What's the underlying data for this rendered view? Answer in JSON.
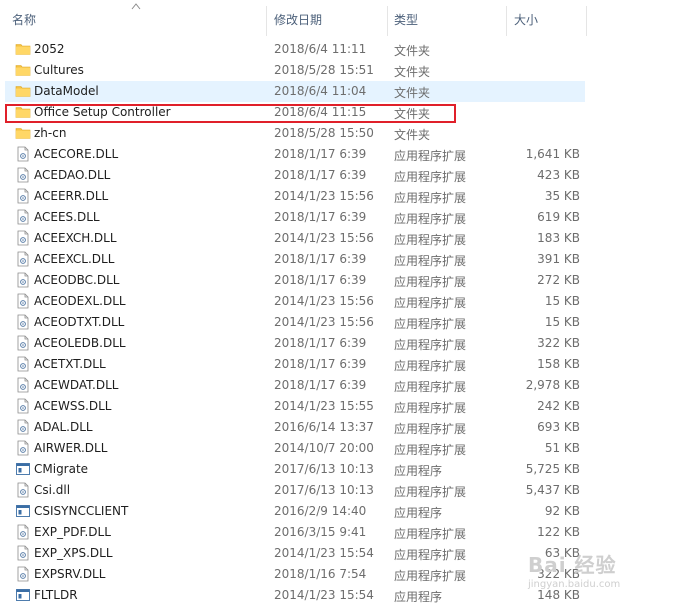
{
  "columns": {
    "name": "名称",
    "date": "修改日期",
    "type": "类型",
    "size": "大小"
  },
  "rows": [
    {
      "name": "2052",
      "date": "2018/6/4 11:11",
      "type": "文件夹",
      "size": "",
      "icon": "folder-icon"
    },
    {
      "name": "Cultures",
      "date": "2018/5/28 15:51",
      "type": "文件夹",
      "size": "",
      "icon": "folder-icon"
    },
    {
      "name": "DataModel",
      "date": "2018/6/4 11:04",
      "type": "文件夹",
      "size": "",
      "icon": "folder-icon",
      "selected": true
    },
    {
      "name": "Office Setup Controller",
      "date": "2018/6/4 11:15",
      "type": "文件夹",
      "size": "",
      "icon": "folder-icon",
      "highlighted": true
    },
    {
      "name": "zh-cn",
      "date": "2018/5/28 15:50",
      "type": "文件夹",
      "size": "",
      "icon": "folder-icon"
    },
    {
      "name": "ACECORE.DLL",
      "date": "2018/1/17 6:39",
      "type": "应用程序扩展",
      "size": "1,641 KB",
      "icon": "dll-file-icon"
    },
    {
      "name": "ACEDAO.DLL",
      "date": "2018/1/17 6:39",
      "type": "应用程序扩展",
      "size": "423 KB",
      "icon": "dll-file-icon"
    },
    {
      "name": "ACEERR.DLL",
      "date": "2014/1/23 15:56",
      "type": "应用程序扩展",
      "size": "35 KB",
      "icon": "dll-file-icon"
    },
    {
      "name": "ACEES.DLL",
      "date": "2018/1/17 6:39",
      "type": "应用程序扩展",
      "size": "619 KB",
      "icon": "dll-file-icon"
    },
    {
      "name": "ACEEXCH.DLL",
      "date": "2014/1/23 15:56",
      "type": "应用程序扩展",
      "size": "183 KB",
      "icon": "dll-file-icon"
    },
    {
      "name": "ACEEXCL.DLL",
      "date": "2018/1/17 6:39",
      "type": "应用程序扩展",
      "size": "391 KB",
      "icon": "dll-file-icon"
    },
    {
      "name": "ACEODBC.DLL",
      "date": "2018/1/17 6:39",
      "type": "应用程序扩展",
      "size": "272 KB",
      "icon": "dll-file-icon"
    },
    {
      "name": "ACEODEXL.DLL",
      "date": "2014/1/23 15:56",
      "type": "应用程序扩展",
      "size": "15 KB",
      "icon": "dll-file-icon"
    },
    {
      "name": "ACEODTXT.DLL",
      "date": "2014/1/23 15:56",
      "type": "应用程序扩展",
      "size": "15 KB",
      "icon": "dll-file-icon"
    },
    {
      "name": "ACEOLEDB.DLL",
      "date": "2018/1/17 6:39",
      "type": "应用程序扩展",
      "size": "322 KB",
      "icon": "dll-file-icon"
    },
    {
      "name": "ACETXT.DLL",
      "date": "2018/1/17 6:39",
      "type": "应用程序扩展",
      "size": "158 KB",
      "icon": "dll-file-icon"
    },
    {
      "name": "ACEWDAT.DLL",
      "date": "2018/1/17 6:39",
      "type": "应用程序扩展",
      "size": "2,978 KB",
      "icon": "dll-file-icon"
    },
    {
      "name": "ACEWSS.DLL",
      "date": "2014/1/23 15:55",
      "type": "应用程序扩展",
      "size": "242 KB",
      "icon": "dll-file-icon"
    },
    {
      "name": "ADAL.DLL",
      "date": "2016/6/14 13:37",
      "type": "应用程序扩展",
      "size": "693 KB",
      "icon": "dll-file-icon"
    },
    {
      "name": "AIRWER.DLL",
      "date": "2014/10/7 20:00",
      "type": "应用程序扩展",
      "size": "51 KB",
      "icon": "dll-file-icon"
    },
    {
      "name": "CMigrate",
      "date": "2017/6/13 10:13",
      "type": "应用程序",
      "size": "5,725 KB",
      "icon": "application-icon"
    },
    {
      "name": "Csi.dll",
      "date": "2017/6/13 10:13",
      "type": "应用程序扩展",
      "size": "5,437 KB",
      "icon": "dll-file-icon"
    },
    {
      "name": "CSISYNCCLIENT",
      "date": "2016/2/9 14:40",
      "type": "应用程序",
      "size": "92 KB",
      "icon": "application-icon"
    },
    {
      "name": "EXP_PDF.DLL",
      "date": "2016/3/15 9:41",
      "type": "应用程序扩展",
      "size": "122 KB",
      "icon": "dll-file-icon"
    },
    {
      "name": "EXP_XPS.DLL",
      "date": "2014/1/23 15:54",
      "type": "应用程序扩展",
      "size": "63 KB",
      "icon": "dll-file-icon"
    },
    {
      "name": "EXPSRV.DLL",
      "date": "2018/1/16 7:54",
      "type": "应用程序扩展",
      "size": "322 KB",
      "icon": "dll-file-icon"
    },
    {
      "name": "FLTLDR",
      "date": "2014/1/23 15:54",
      "type": "应用程序",
      "size": "148 KB",
      "icon": "application-icon"
    }
  ],
  "watermark": {
    "text": "Bai 经验",
    "url": "jingyan.baidu.com"
  },
  "colors": {
    "header_text": "#4c607a",
    "selection_bg": "#e5f3ff",
    "highlight_border": "#e0202a",
    "folder": "#f5c242"
  }
}
